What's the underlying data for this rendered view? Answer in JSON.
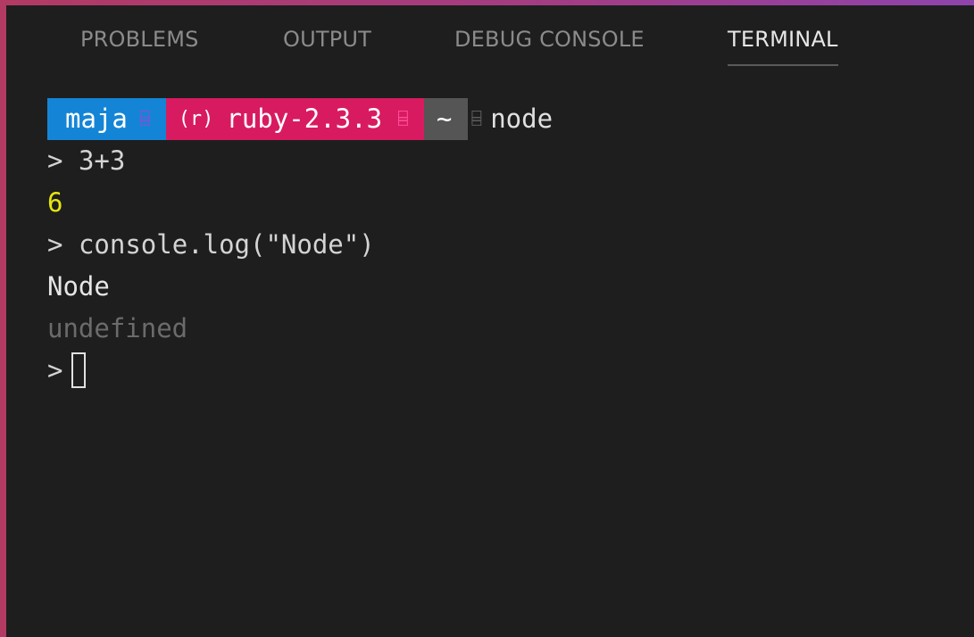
{
  "tabs": [
    {
      "label": "PROBLEMS",
      "active": false
    },
    {
      "label": "OUTPUT",
      "active": false
    },
    {
      "label": "DEBUG CONSOLE",
      "active": false
    },
    {
      "label": "TERMINAL",
      "active": true
    }
  ],
  "prompt": {
    "user": "maja",
    "ruby_marker": "(r)",
    "ruby_version": "ruby-2.3.3",
    "directory": "~",
    "command": "node",
    "separator_glyph": "⌸",
    "colors": {
      "user_bg": "#1485d6",
      "ruby_bg": "#d81b60",
      "dir_bg": "#555555"
    }
  },
  "terminal_lines": [
    {
      "type": "input",
      "caret": ">",
      "text": "3+3"
    },
    {
      "type": "output",
      "text": "6",
      "color": "#e5e510"
    },
    {
      "type": "input",
      "caret": ">",
      "text": "console.log(\"Node\")"
    },
    {
      "type": "output",
      "text": "Node",
      "color": "#e6e6e6"
    },
    {
      "type": "output",
      "text": "undefined",
      "color": "#6b6b6b"
    },
    {
      "type": "input",
      "caret": ">",
      "text": ""
    }
  ]
}
